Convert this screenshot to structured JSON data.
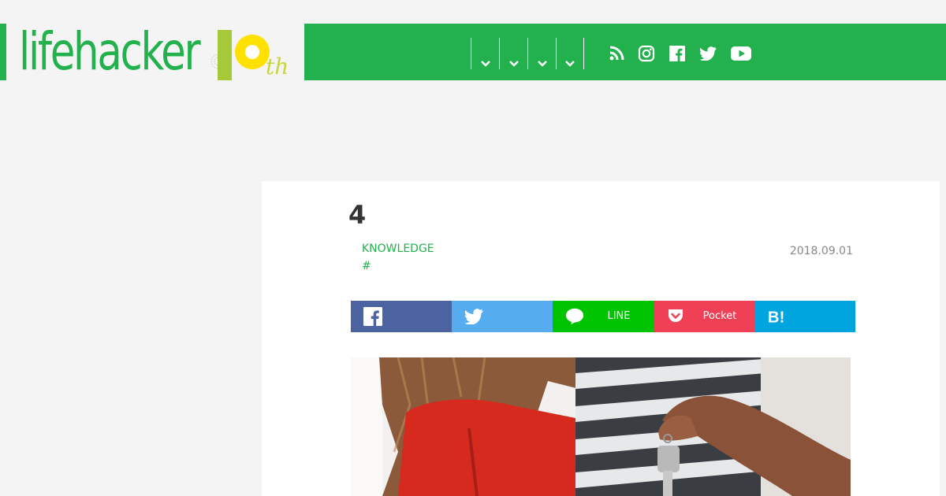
{
  "header": {
    "logo_text": "lifehacker",
    "logo_anniversary": "th",
    "nav_dropdowns": [
      "menu-1",
      "menu-2",
      "menu-3",
      "menu-4"
    ],
    "social_icons": [
      "rss-icon",
      "instagram-icon",
      "facebook-icon",
      "twitter-icon",
      "youtube-icon"
    ],
    "brand_color": "#23b14d"
  },
  "article": {
    "title": "4",
    "category": "KNOWLEDGE",
    "tag": "#",
    "date": "2018.09.01"
  },
  "share": {
    "line_label": "LINE",
    "pocket_label": "Pocket",
    "colors": {
      "facebook": "#4b63a0",
      "twitter": "#55acee",
      "line": "#00c300",
      "pocket": "#ef4056",
      "hatena": "#00a4de"
    }
  }
}
